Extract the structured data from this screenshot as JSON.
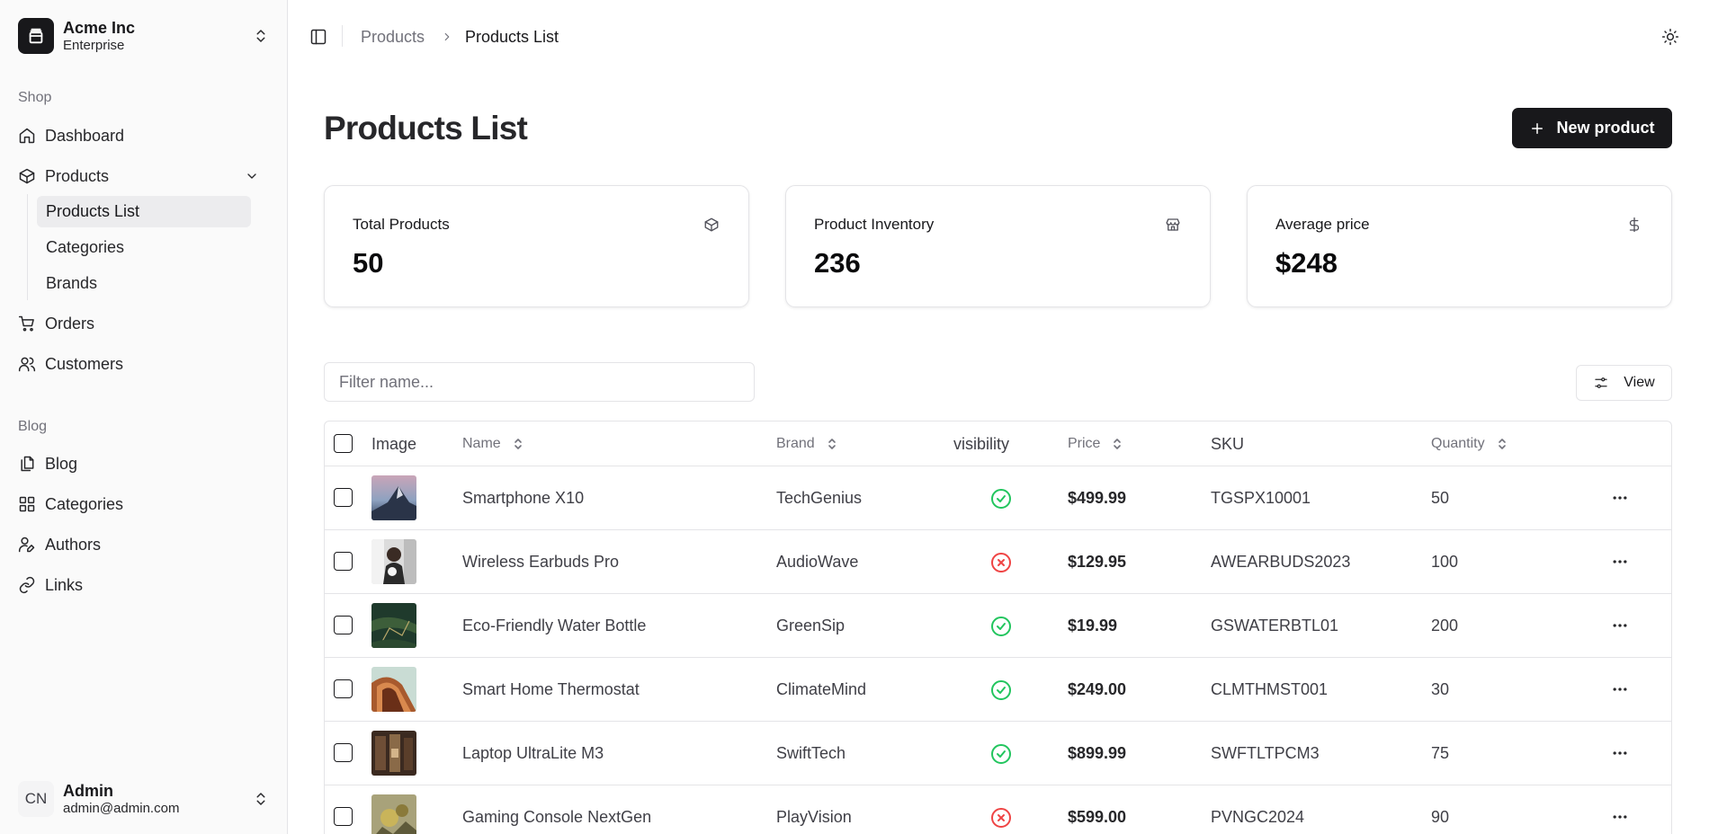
{
  "sidebar": {
    "team_name": "Acme Inc",
    "team_plan": "Enterprise",
    "shop_label": "Shop",
    "shop_items": {
      "dashboard": "Dashboard",
      "products": "Products",
      "orders": "Orders",
      "customers": "Customers"
    },
    "products_sub": {
      "list": "Products List",
      "categories": "Categories",
      "brands": "Brands"
    },
    "blog_label": "Blog",
    "blog_items": {
      "blog": "Blog",
      "categories": "Categories",
      "authors": "Authors",
      "links": "Links"
    },
    "user": {
      "initials": "CN",
      "name": "Admin",
      "email": "admin@admin.com"
    }
  },
  "header": {
    "breadcrumb": [
      "Products",
      "Products List"
    ]
  },
  "page": {
    "title": "Products List",
    "new_button": "New product"
  },
  "stats": [
    {
      "title": "Total Products",
      "value": "50",
      "icon": "package-icon"
    },
    {
      "title": "Product Inventory",
      "value": "236",
      "icon": "store-icon"
    },
    {
      "title": "Average price",
      "value": "$248",
      "icon": "dollar-icon"
    }
  ],
  "toolbar": {
    "filter_placeholder": "Filter name...",
    "filter_value": "",
    "view_label": "View"
  },
  "table": {
    "columns": {
      "image": "Image",
      "name": "Name",
      "brand": "Brand",
      "visibility": "visibility",
      "price": "Price",
      "sku": "SKU",
      "quantity": "Quantity"
    },
    "rows": [
      {
        "name": "Smartphone X10",
        "brand": "TechGenius",
        "visible": true,
        "price": "$499.99",
        "sku": "TGSPX10001",
        "quantity": "50"
      },
      {
        "name": "Wireless Earbuds Pro",
        "brand": "AudioWave",
        "visible": false,
        "price": "$129.95",
        "sku": "AWEARBUDS2023",
        "quantity": "100"
      },
      {
        "name": "Eco-Friendly Water Bottle",
        "brand": "GreenSip",
        "visible": true,
        "price": "$19.99",
        "sku": "GSWATERBTL01",
        "quantity": "200"
      },
      {
        "name": "Smart Home Thermostat",
        "brand": "ClimateMind",
        "visible": true,
        "price": "$249.00",
        "sku": "CLMTHMST001",
        "quantity": "30"
      },
      {
        "name": "Laptop UltraLite M3",
        "brand": "SwiftTech",
        "visible": true,
        "price": "$899.99",
        "sku": "SWFTLTPCM3",
        "quantity": "75"
      },
      {
        "name": "Gaming Console NextGen",
        "brand": "PlayVision",
        "visible": false,
        "price": "$599.00",
        "sku": "PVNGC2024",
        "quantity": "90"
      }
    ]
  },
  "colors": {
    "primary": "#18181b",
    "visible": "#22c55e",
    "hidden": "#ef4444",
    "muted": "#71717a"
  }
}
